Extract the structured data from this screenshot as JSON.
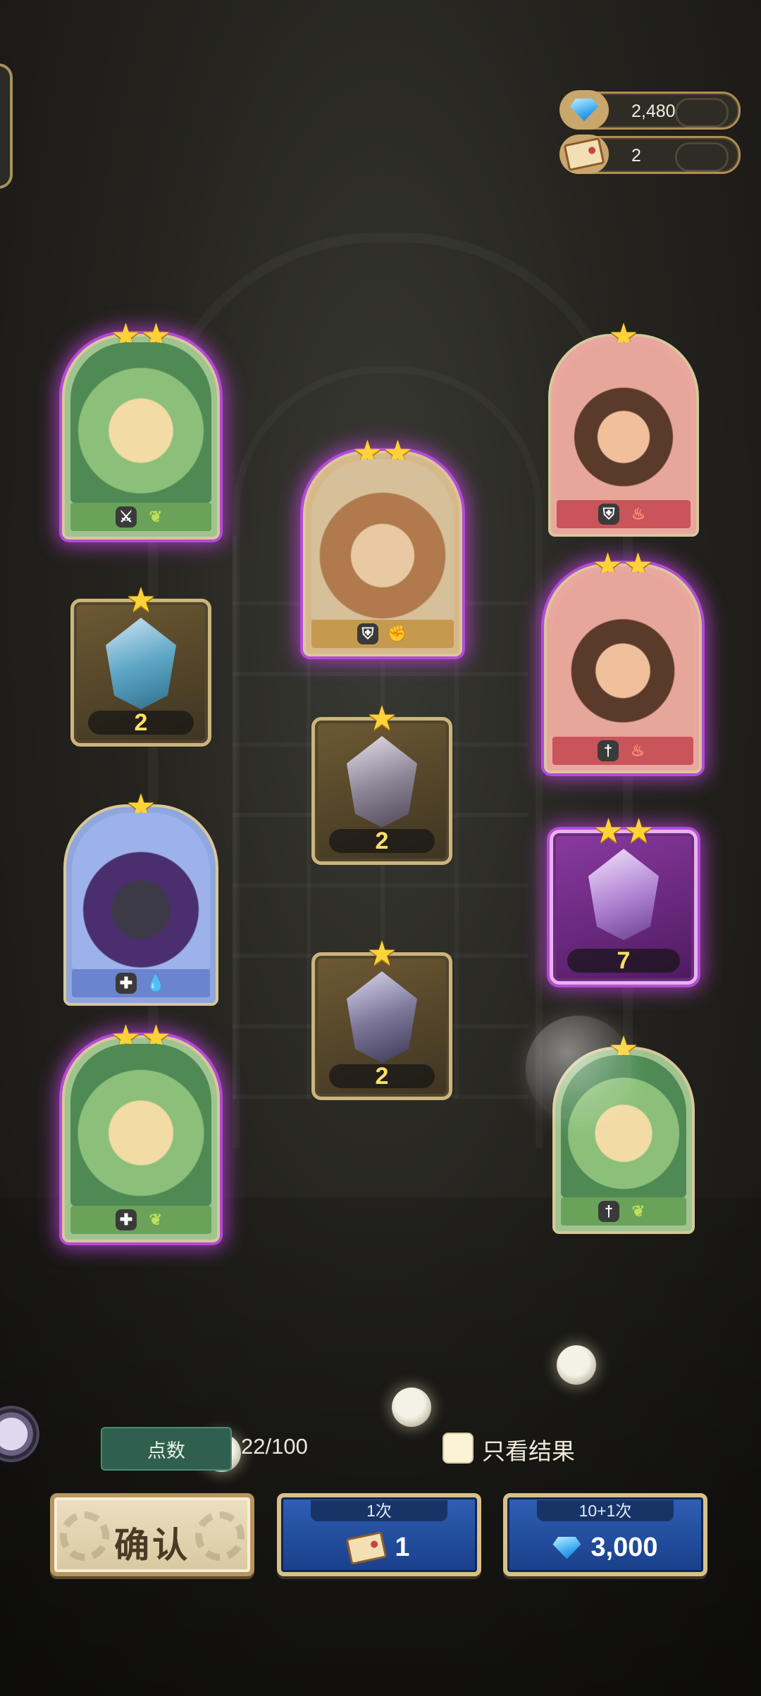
{
  "currency": {
    "gems": "2,480",
    "tickets": "2"
  },
  "cards": [
    {
      "id": "fairy-green",
      "stars": "★★",
      "roles": [
        "ranged",
        "leaf"
      ]
    },
    {
      "id": "horned-warrior",
      "stars": "★★",
      "roles": [
        "tank",
        "fist"
      ]
    },
    {
      "id": "pirate",
      "stars": "★",
      "roles": [
        "tank",
        "fire"
      ]
    },
    {
      "id": "goggles-warrior",
      "stars": "★★",
      "roles": [
        "melee",
        "fire"
      ]
    },
    {
      "id": "plague-doctor",
      "stars": "★",
      "roles": [
        "healer",
        "water"
      ]
    },
    {
      "id": "butterfly-fairy",
      "stars": "★★",
      "roles": [
        "healer",
        "leaf"
      ]
    },
    {
      "id": "white-hair",
      "stars": "★",
      "roles": [
        "melee",
        "leaf"
      ]
    }
  ],
  "shards": [
    {
      "id": "shard-blue",
      "stars": "★",
      "count": "2"
    },
    {
      "id": "shard-witch",
      "stars": "★",
      "count": "2"
    },
    {
      "id": "shard-doctor",
      "stars": "★",
      "count": "2"
    },
    {
      "id": "shard-purple",
      "stars": "★★",
      "count": "7"
    }
  ],
  "bottom": {
    "points_label": "点数",
    "points_value": "22/100",
    "result_only_label": "只看结果",
    "confirm_label": "确认",
    "single_pull": {
      "tab": "1次",
      "cost": "1"
    },
    "multi_pull": {
      "tab": "10+1次",
      "cost": "3,000"
    }
  },
  "colors": {
    "purple_glow": "#b44bd6",
    "pull_button_blue": "#2f5fb4",
    "confirm_button": "#ece0c2"
  }
}
